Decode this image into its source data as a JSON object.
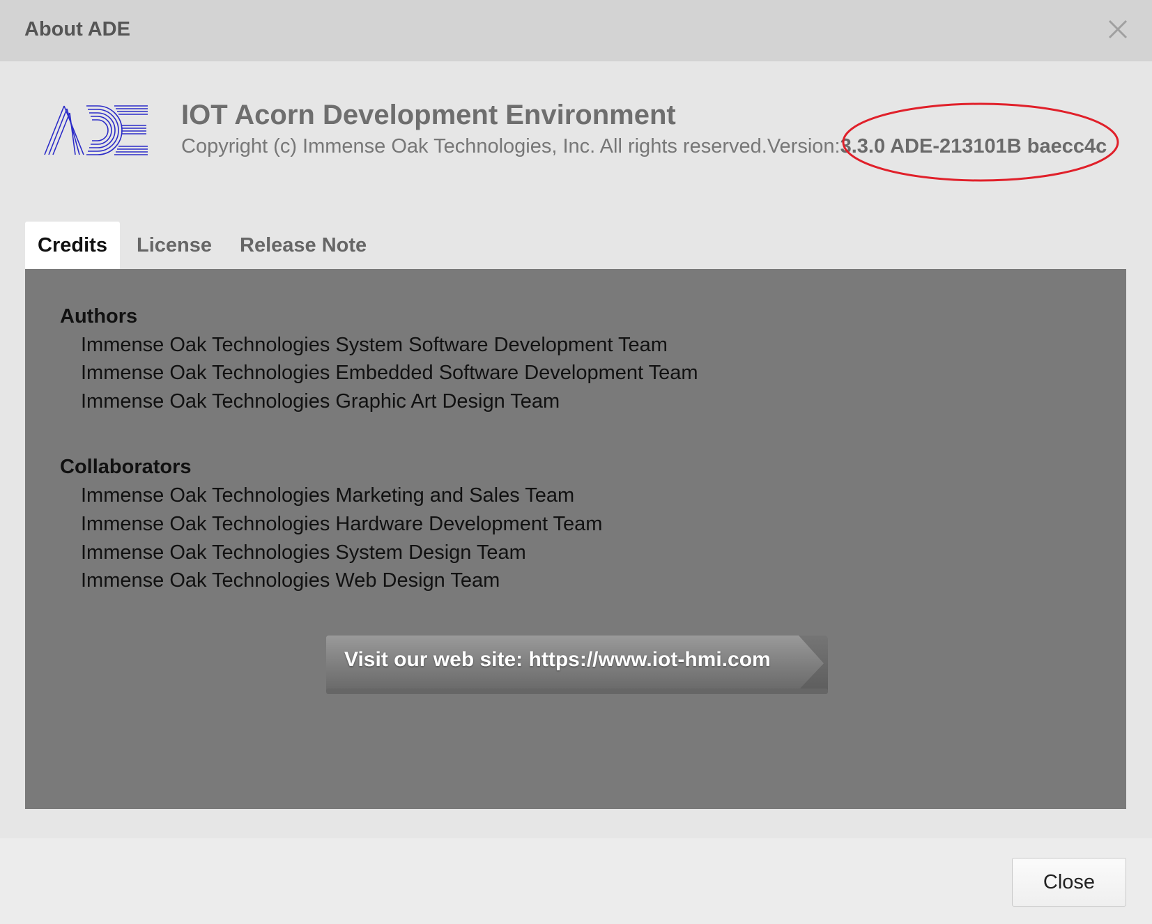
{
  "dialog": {
    "title": "About ADE"
  },
  "header": {
    "logo_text": "ADE",
    "app_name": "IOT Acorn Development Environment",
    "copyright": "Copyright (c) Immense Oak Technologies, Inc. All rights reserved.Version:",
    "version": "3.3.0 ADE-213101B baecc4c"
  },
  "tabs": [
    {
      "label": "Credits",
      "active": true
    },
    {
      "label": "License",
      "active": false
    },
    {
      "label": "Release Note",
      "active": false
    }
  ],
  "credits": {
    "authors_heading": "Authors",
    "authors": [
      "Immense Oak Technologies System Software Development Team",
      "Immense Oak Technologies Embedded Software Development Team",
      "Immense Oak Technologies Graphic Art Design Team"
    ],
    "collaborators_heading": "Collaborators",
    "collaborators": [
      "Immense Oak Technologies Marketing and Sales Team",
      "Immense Oak Technologies Hardware Development Team",
      "Immense Oak Technologies System Design Team",
      "Immense Oak Technologies Web Design Team"
    ],
    "website_button_label": "Visit our web site: https://www.iot-hmi.com"
  },
  "footer": {
    "close_label": "Close"
  },
  "colors": {
    "titlebar": "#d3d3d3",
    "dialog_bg": "#e6e6e6",
    "panel_bg": "#7a7a7a",
    "logo_blue": "#2c2cc8",
    "highlight_red": "#e0202a"
  },
  "icons": {
    "close": "close-icon",
    "logo": "ade-logo-icon"
  }
}
